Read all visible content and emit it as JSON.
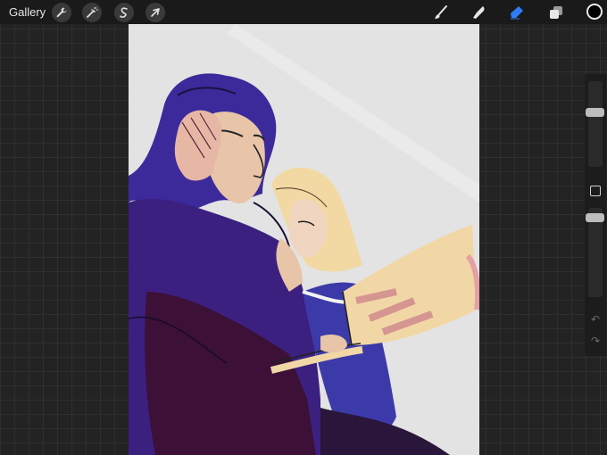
{
  "topbar": {
    "gallery_label": "Gallery",
    "left_tools": [
      {
        "name": "actions",
        "icon": "wrench-icon"
      },
      {
        "name": "adjustments",
        "icon": "magic-wand-icon"
      },
      {
        "name": "selection",
        "icon": "selection-s-icon"
      },
      {
        "name": "transform",
        "icon": "cursor-arrow-icon"
      }
    ],
    "right_tools": [
      {
        "name": "brush",
        "icon": "brush-icon"
      },
      {
        "name": "smudge",
        "icon": "smudge-icon"
      },
      {
        "name": "eraser",
        "icon": "eraser-icon",
        "active": true,
        "accent": "#2f7cf6"
      },
      {
        "name": "layers",
        "icon": "layers-icon"
      }
    ],
    "current_color": "#000000"
  },
  "canvas": {
    "background": "#e3e3e3",
    "content": "artwork"
  },
  "sidebar": {
    "brush_size_level": 0.12,
    "opacity_level": 0.05,
    "modifier_icon": "square-modifier-icon",
    "undo_icon": "undo-arrow-icon",
    "redo_icon": "redo-arrow-icon"
  }
}
